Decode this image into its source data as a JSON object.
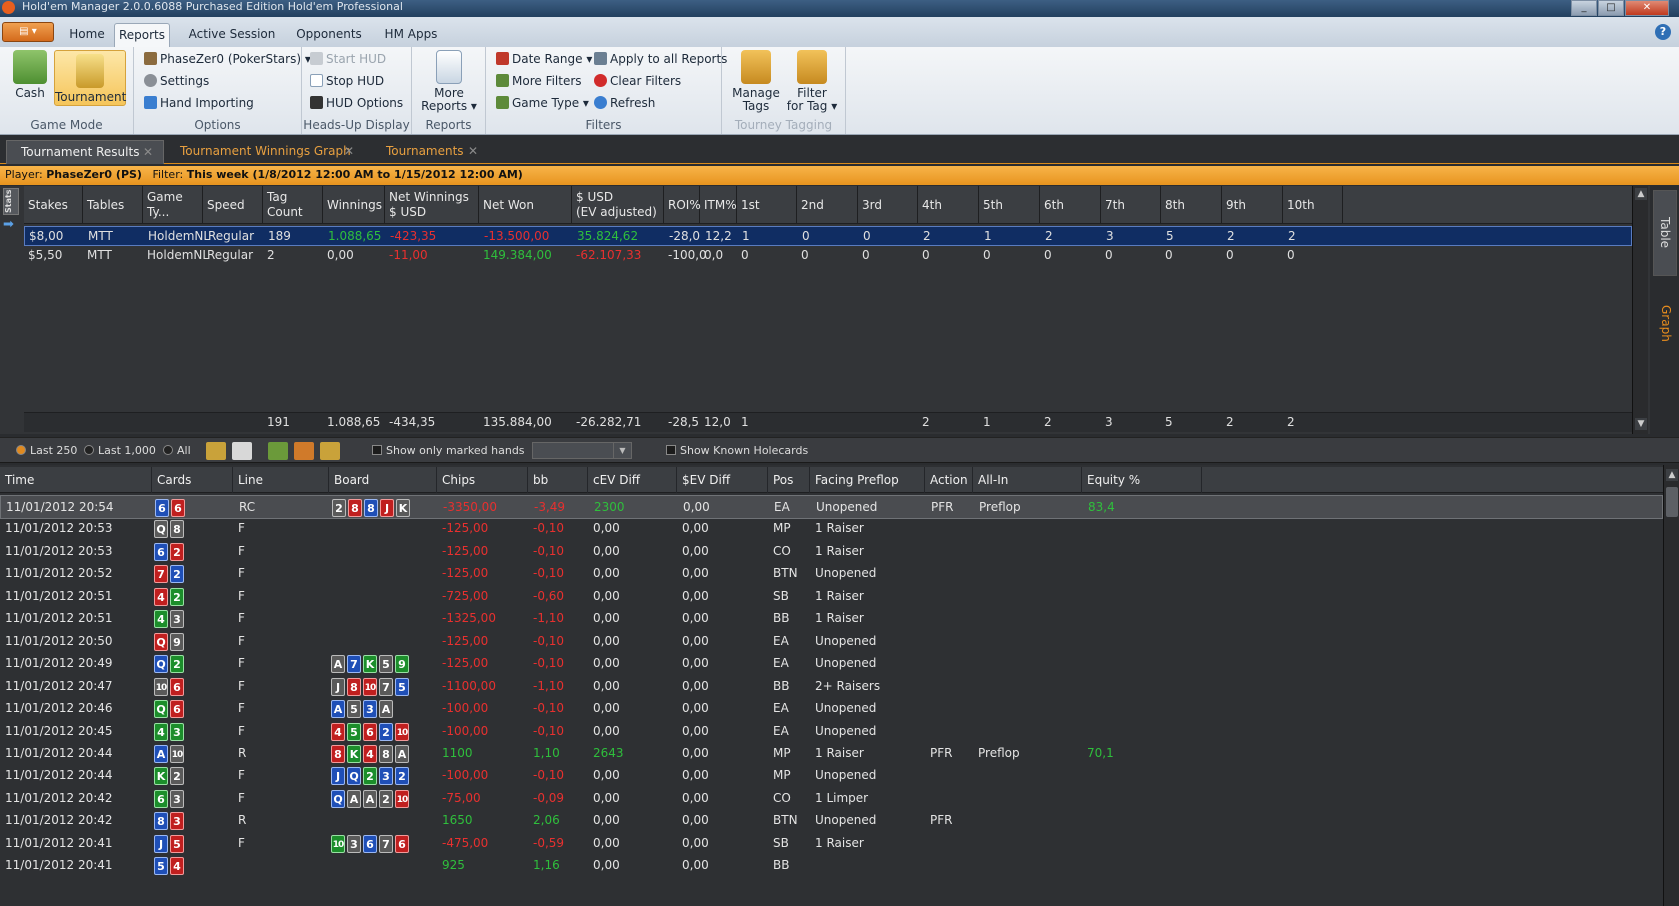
{
  "window": {
    "title": "Hold'em Manager 2.0.0.6088 Purchased Edition Hold'em Professional"
  },
  "menu": {
    "tabs": [
      "Home",
      "Reports",
      "Active Session",
      "Opponents",
      "HM Apps"
    ],
    "active": "Reports",
    "help": "?"
  },
  "ribbon": {
    "game_mode": {
      "label": "Game Mode",
      "cash": "Cash",
      "tournament": "Tournament"
    },
    "options": {
      "label": "Options",
      "player": "PhaseZer0 (PokerStars) ▾",
      "settings": "Settings",
      "hand_importing": "Hand Importing"
    },
    "hud": {
      "label": "Heads-Up Display",
      "start": "Start HUD",
      "stop": "Stop HUD",
      "options": "HUD Options"
    },
    "reports": {
      "label": "Reports",
      "more_line1": "More",
      "more_line2": "Reports ▾"
    },
    "filters": {
      "label": "Filters",
      "date_range": "Date Range ▾",
      "more_filters": "More Filters",
      "game_type": "Game Type ▾",
      "apply_all": "Apply to all Reports",
      "clear": "Clear Filters",
      "refresh": "Refresh"
    },
    "tagging": {
      "label": "Tourney Tagging",
      "manage_line1": "Manage",
      "manage_line2": "Tags",
      "filter_line1": "Filter",
      "filter_line2": "for Tag ▾"
    }
  },
  "doc_tabs": [
    "Tournament Results",
    "Tournament Winnings Graph",
    "Tournaments"
  ],
  "filter_bar": {
    "player_label": "Player:",
    "player": "PhaseZer0 (PS)",
    "filter_label": "Filter:",
    "filter": "This week (1/8/2012 12:00 AM to 1/15/2012 12:00 AM)"
  },
  "stats": {
    "icon": "Stats",
    "columns": [
      "Stakes",
      "Tables",
      "Game Ty...",
      "Speed",
      "Tag Count",
      "Winnings",
      "Net Winnings\n$ USD",
      "Net Won",
      "$ USD\n(EV adjusted)",
      "ROI%",
      "ITM%",
      "1st",
      "2nd",
      "3rd",
      "4th",
      "5th",
      "6th",
      "7th",
      "8th",
      "9th",
      "10th"
    ],
    "rows": [
      [
        "$8,00",
        "MTT",
        "HoldemNL",
        "Regular",
        "189",
        "1.088,65",
        "-423,35",
        "-13.500,00",
        "35.824,62",
        "-28,0",
        "12,2",
        "1",
        "0",
        "0",
        "2",
        "1",
        "2",
        "3",
        "5",
        "2",
        "2"
      ],
      [
        "$5,50",
        "MTT",
        "HoldemNL",
        "Regular",
        "2",
        "0,00",
        "-11,00",
        "149.384,00",
        "-62.107,33",
        "-100,0",
        "0,0",
        "0",
        "0",
        "0",
        "0",
        "0",
        "0",
        "0",
        "0",
        "0",
        "0"
      ]
    ],
    "totals": [
      "",
      "",
      "",
      "",
      "191",
      "1.088,65",
      "-434,35",
      "135.884,00",
      "-26.282,71",
      "-28,5",
      "12,0",
      "1",
      "",
      "",
      "2",
      "1",
      "2",
      "3",
      "5",
      "2",
      "2"
    ]
  },
  "side_tabs": [
    "Table",
    "Graph"
  ],
  "toolbar": {
    "last250": "Last 250",
    "last1000": "Last 1,000",
    "all": "All",
    "marked": "Show only marked hands",
    "known": "Show Known Holecards"
  },
  "hands": {
    "columns": [
      "Time",
      "Cards",
      "Line",
      "Board",
      "Chips",
      "bb",
      "cEV Diff",
      "$EV Diff",
      "Pos",
      "Facing Preflop",
      "Action",
      "All-In",
      "Equity %"
    ],
    "rows": [
      {
        "time": "11/01/2012 20:54",
        "cards": [
          [
            "6",
            "d"
          ],
          [
            "6",
            "h"
          ]
        ],
        "line": "RC",
        "board": [
          [
            "2",
            "s"
          ],
          [
            "8",
            "h"
          ],
          [
            "8",
            "d"
          ],
          [
            "J",
            "h"
          ],
          [
            "K",
            "s"
          ]
        ],
        "chips": "-3350,00",
        "bb": "-3,49",
        "cev": "2300",
        "sev": "0,00",
        "pos": "EA",
        "facing": "Unopened",
        "action": "PFR",
        "allin": "Preflop",
        "equity": "83,4"
      },
      {
        "time": "11/01/2012 20:53",
        "cards": [
          [
            "Q",
            "s"
          ],
          [
            "8",
            "s"
          ]
        ],
        "line": "F",
        "board": [],
        "chips": "-125,00",
        "bb": "-0,10",
        "cev": "0,00",
        "sev": "0,00",
        "pos": "MP",
        "facing": "1 Raiser",
        "action": "",
        "allin": "",
        "equity": ""
      },
      {
        "time": "11/01/2012 20:53",
        "cards": [
          [
            "6",
            "d"
          ],
          [
            "2",
            "h"
          ]
        ],
        "line": "F",
        "board": [],
        "chips": "-125,00",
        "bb": "-0,10",
        "cev": "0,00",
        "sev": "0,00",
        "pos": "CO",
        "facing": "1 Raiser",
        "action": "",
        "allin": "",
        "equity": ""
      },
      {
        "time": "11/01/2012 20:52",
        "cards": [
          [
            "7",
            "h"
          ],
          [
            "2",
            "d"
          ]
        ],
        "line": "F",
        "board": [],
        "chips": "-125,00",
        "bb": "-0,10",
        "cev": "0,00",
        "sev": "0,00",
        "pos": "BTN",
        "facing": "Unopened",
        "action": "",
        "allin": "",
        "equity": ""
      },
      {
        "time": "11/01/2012 20:51",
        "cards": [
          [
            "4",
            "h"
          ],
          [
            "2",
            "c"
          ]
        ],
        "line": "F",
        "board": [],
        "chips": "-725,00",
        "bb": "-0,60",
        "cev": "0,00",
        "sev": "0,00",
        "pos": "SB",
        "facing": "1 Raiser",
        "action": "",
        "allin": "",
        "equity": ""
      },
      {
        "time": "11/01/2012 20:51",
        "cards": [
          [
            "4",
            "c"
          ],
          [
            "3",
            "s"
          ]
        ],
        "line": "F",
        "board": [],
        "chips": "-1325,00",
        "bb": "-1,10",
        "cev": "0,00",
        "sev": "0,00",
        "pos": "BB",
        "facing": "1 Raiser",
        "action": "",
        "allin": "",
        "equity": ""
      },
      {
        "time": "11/01/2012 20:50",
        "cards": [
          [
            "Q",
            "h"
          ],
          [
            "9",
            "s"
          ]
        ],
        "line": "F",
        "board": [],
        "chips": "-125,00",
        "bb": "-0,10",
        "cev": "0,00",
        "sev": "0,00",
        "pos": "EA",
        "facing": "Unopened",
        "action": "",
        "allin": "",
        "equity": ""
      },
      {
        "time": "11/01/2012 20:49",
        "cards": [
          [
            "Q",
            "d"
          ],
          [
            "2",
            "c"
          ]
        ],
        "line": "F",
        "board": [
          [
            "A",
            "s"
          ],
          [
            "7",
            "d"
          ],
          [
            "K",
            "c"
          ],
          [
            "5",
            "s"
          ],
          [
            "9",
            "c"
          ]
        ],
        "chips": "-125,00",
        "bb": "-0,10",
        "cev": "0,00",
        "sev": "0,00",
        "pos": "EA",
        "facing": "Unopened",
        "action": "",
        "allin": "",
        "equity": ""
      },
      {
        "time": "11/01/2012 20:47",
        "cards": [
          [
            "10",
            "s"
          ],
          [
            "6",
            "h"
          ]
        ],
        "line": "F",
        "board": [
          [
            "J",
            "s"
          ],
          [
            "8",
            "h"
          ],
          [
            "10",
            "h"
          ],
          [
            "7",
            "s"
          ],
          [
            "5",
            "d"
          ]
        ],
        "chips": "-1100,00",
        "bb": "-1,10",
        "cev": "0,00",
        "sev": "0,00",
        "pos": "BB",
        "facing": "2+ Raisers",
        "action": "",
        "allin": "",
        "equity": ""
      },
      {
        "time": "11/01/2012 20:46",
        "cards": [
          [
            "Q",
            "c"
          ],
          [
            "6",
            "h"
          ]
        ],
        "line": "F",
        "board": [
          [
            "A",
            "d"
          ],
          [
            "5",
            "s"
          ],
          [
            "3",
            "d"
          ],
          [
            "A",
            "s"
          ]
        ],
        "chips": "-100,00",
        "bb": "-0,10",
        "cev": "0,00",
        "sev": "0,00",
        "pos": "EA",
        "facing": "Unopened",
        "action": "",
        "allin": "",
        "equity": ""
      },
      {
        "time": "11/01/2012 20:45",
        "cards": [
          [
            "4",
            "c"
          ],
          [
            "3",
            "c"
          ]
        ],
        "line": "F",
        "board": [
          [
            "4",
            "h"
          ],
          [
            "5",
            "c"
          ],
          [
            "6",
            "h"
          ],
          [
            "2",
            "d"
          ],
          [
            "10",
            "h"
          ]
        ],
        "chips": "-100,00",
        "bb": "-0,10",
        "cev": "0,00",
        "sev": "0,00",
        "pos": "EA",
        "facing": "Unopened",
        "action": "",
        "allin": "",
        "equity": ""
      },
      {
        "time": "11/01/2012 20:44",
        "cards": [
          [
            "A",
            "d"
          ],
          [
            "10",
            "s"
          ]
        ],
        "line": "R",
        "board": [
          [
            "8",
            "h"
          ],
          [
            "K",
            "c"
          ],
          [
            "4",
            "h"
          ],
          [
            "8",
            "s"
          ],
          [
            "A",
            "s"
          ]
        ],
        "chips": "1100",
        "bb": "1,10",
        "cev": "2643",
        "sev": "0,00",
        "pos": "MP",
        "facing": "1 Raiser",
        "action": "PFR",
        "allin": "Preflop",
        "equity": "70,1"
      },
      {
        "time": "11/01/2012 20:44",
        "cards": [
          [
            "K",
            "c"
          ],
          [
            "2",
            "s"
          ]
        ],
        "line": "F",
        "board": [
          [
            "J",
            "d"
          ],
          [
            "Q",
            "d"
          ],
          [
            "2",
            "c"
          ],
          [
            "3",
            "d"
          ],
          [
            "2",
            "d"
          ]
        ],
        "chips": "-100,00",
        "bb": "-0,10",
        "cev": "0,00",
        "sev": "0,00",
        "pos": "MP",
        "facing": "Unopened",
        "action": "",
        "allin": "",
        "equity": ""
      },
      {
        "time": "11/01/2012 20:42",
        "cards": [
          [
            "6",
            "c"
          ],
          [
            "3",
            "s"
          ]
        ],
        "line": "F",
        "board": [
          [
            "Q",
            "d"
          ],
          [
            "A",
            "s"
          ],
          [
            "A",
            "s"
          ],
          [
            "2",
            "s"
          ],
          [
            "10",
            "h"
          ]
        ],
        "chips": "-75,00",
        "bb": "-0,09",
        "cev": "0,00",
        "sev": "0,00",
        "pos": "CO",
        "facing": "1 Limper",
        "action": "",
        "allin": "",
        "equity": ""
      },
      {
        "time": "11/01/2012 20:42",
        "cards": [
          [
            "8",
            "d"
          ],
          [
            "3",
            "h"
          ]
        ],
        "line": "R",
        "board": [],
        "chips": "1650",
        "bb": "2,06",
        "cev": "0,00",
        "sev": "0,00",
        "pos": "BTN",
        "facing": "Unopened",
        "action": "PFR",
        "allin": "",
        "equity": ""
      },
      {
        "time": "11/01/2012 20:41",
        "cards": [
          [
            "J",
            "d"
          ],
          [
            "5",
            "h"
          ]
        ],
        "line": "F",
        "board": [
          [
            "10",
            "c"
          ],
          [
            "3",
            "s"
          ],
          [
            "6",
            "d"
          ],
          [
            "7",
            "s"
          ],
          [
            "6",
            "h"
          ]
        ],
        "chips": "-475,00",
        "bb": "-0,59",
        "cev": "0,00",
        "sev": "0,00",
        "pos": "SB",
        "facing": "1 Raiser",
        "action": "",
        "allin": "",
        "equity": ""
      },
      {
        "time": "11/01/2012 20:41",
        "cards": [
          [
            "5",
            "d"
          ],
          [
            "4",
            "h"
          ]
        ],
        "line": "",
        "board": [],
        "chips": "925",
        "bb": "1,16",
        "cev": "0,00",
        "sev": "0,00",
        "pos": "BB",
        "facing": "",
        "action": "",
        "allin": "",
        "equity": ""
      }
    ]
  }
}
